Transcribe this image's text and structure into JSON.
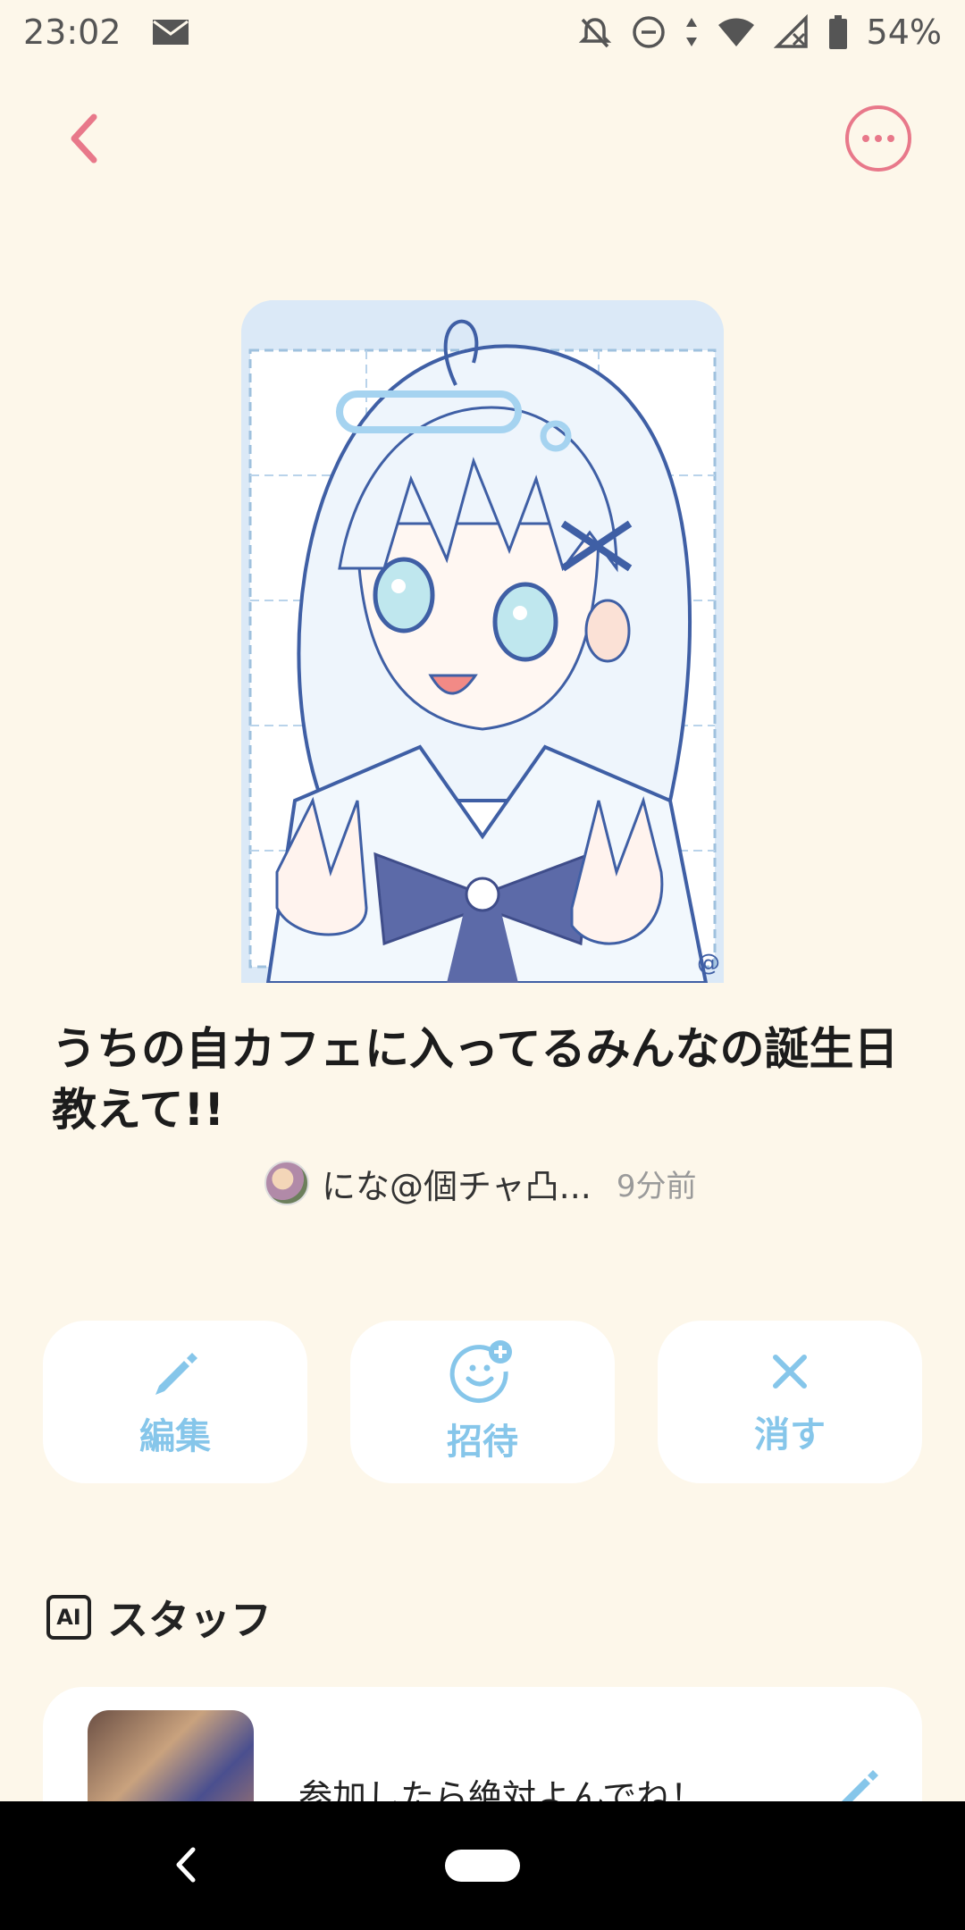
{
  "status_bar": {
    "time": "23:02",
    "battery": "54%",
    "icons": [
      "mail-icon",
      "bell-off-icon",
      "dnd-icon",
      "data-arrows-icon",
      "wifi-icon",
      "signal-off-icon",
      "battery-icon"
    ]
  },
  "nav": {
    "back_icon": "chevron-left-icon",
    "more_icon": "more-horizontal-icon",
    "accent": "#e8788a"
  },
  "post": {
    "title": "うちの自カフェに入ってるみんなの誕生日教えて!!",
    "author": "にな@個チャ凸...",
    "time": "9分前",
    "watermark": "@"
  },
  "actions": [
    {
      "label": "編集",
      "icon": "pencil-icon"
    },
    {
      "label": "招待",
      "icon": "invite-smile-icon"
    },
    {
      "label": "消す",
      "icon": "close-icon"
    }
  ],
  "staff_section": {
    "badge": "AI",
    "title": "スタッフ",
    "card_text": "参加したら絶対よんでね！"
  },
  "colors": {
    "background": "#fdf7ea",
    "action_label": "#86c6ea",
    "accent_pink": "#e8788a"
  }
}
